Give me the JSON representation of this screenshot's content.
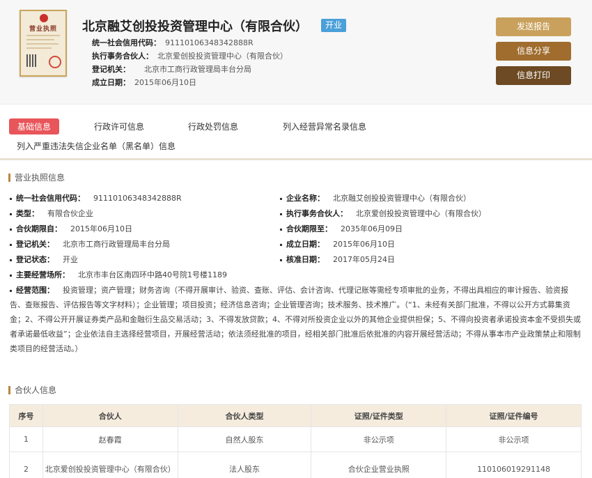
{
  "company": {
    "license_title": "营业执照",
    "name": "北京融艾创投投资管理中心（有限合伙）",
    "status": "开业",
    "credit_code_label": "统一社会信用代码：",
    "credit_code": "91110106348342888R",
    "partner_label": "执行事务合伙人：",
    "partner": "北京爱创投投资管理中心（有限合伙）",
    "authority_label": "登记机关：",
    "authority": "北京市工商行政管理局丰台分局",
    "founded_label": "成立日期：",
    "founded": "2015年06月10日"
  },
  "actions": {
    "send_report": "发送报告",
    "share": "信息分享",
    "print": "信息打印"
  },
  "tabs": [
    "基础信息",
    "行政许可信息",
    "行政处罚信息",
    "列入经营异常名录信息",
    "列入严重违法失信企业名单（黑名单）信息"
  ],
  "license_section": {
    "title": "营业执照信息",
    "fields_left": [
      {
        "label": "统一社会信用代码：",
        "value": "91110106348342888R"
      },
      {
        "label": "类型：",
        "value": "有限合伙企业"
      },
      {
        "label": "合伙期限自：",
        "value": "2015年06月10日"
      },
      {
        "label": "登记机关：",
        "value": "北京市工商行政管理局丰台分局"
      },
      {
        "label": "登记状态：",
        "value": "开业"
      },
      {
        "label": "主要经营场所：",
        "value": "北京市丰台区南四环中路40号院1号楼1189"
      }
    ],
    "fields_right": [
      {
        "label": "企业名称：",
        "value": "北京融艾创投投资管理中心（有限合伙）"
      },
      {
        "label": "执行事务合伙人：",
        "value": "北京爱创投投资管理中心（有限合伙）"
      },
      {
        "label": "合伙期限至：",
        "value": "2035年06月09日"
      },
      {
        "label": "成立日期：",
        "value": "2015年06月10日"
      },
      {
        "label": "核准日期：",
        "value": "2017年05月24日"
      }
    ],
    "scope_label": "经营范围：",
    "scope": "投资管理；资产管理；财务咨询（不得开展审计、验资、查账、评估、会计咨询、代理记账等需经专项审批的业务，不得出具相应的审计报告、验资报告、查账报告、评估报告等文字材料）；企业管理；项目投资；经济信息咨询；企业管理咨询；技术服务、技术推广。（“1、未经有关部门批准，不得以公开方式募集资金；2、不得公开开展证券类产品和金融衍生品交易活动；3、不得发放贷款；4、不得对所投资企业以外的其他企业提供担保；5、不得向投资者承诺投资本金不受损失或者承诺最低收益”；企业依法自主选择经营项目，开展经营活动；依法须经批准的项目，经相关部门批准后依批准的内容开展经营活动；不得从事本市产业政策禁止和限制类项目的经营活动。）"
  },
  "partners_section": {
    "title": "合伙人信息",
    "columns": [
      "序号",
      "合伙人",
      "合伙人类型",
      "证照/证件类型",
      "证照/证件编号"
    ],
    "rows": [
      [
        "1",
        "赵春霞",
        "自然人股东",
        "非公示项",
        "非公示项"
      ],
      [
        "2",
        "北京爱创投投资管理中心（有限合伙）",
        "法人股东",
        "合伙企业营业执照",
        "110106019291148"
      ]
    ]
  }
}
